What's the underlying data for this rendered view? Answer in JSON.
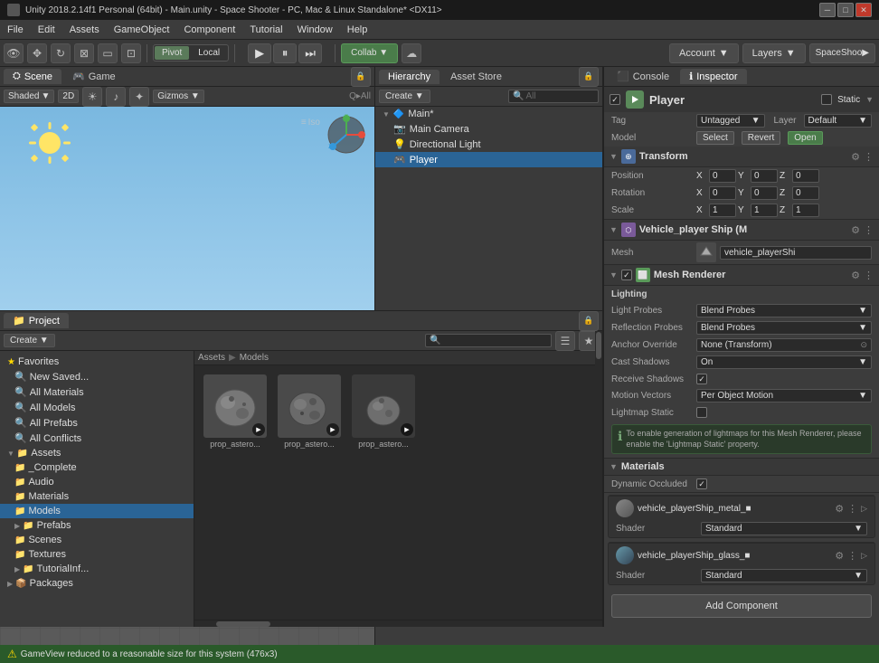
{
  "titleBar": {
    "title": "Unity 2018.2.14f1 Personal (64bit) - Main.unity - Space Shooter - PC, Mac & Linux Standalone* <DX11>",
    "minBtn": "─",
    "maxBtn": "□",
    "closeBtn": "✕"
  },
  "menuBar": {
    "items": [
      "File",
      "Edit",
      "Assets",
      "GameObject",
      "Component",
      "Tutorial",
      "Window",
      "Help"
    ]
  },
  "toolbar": {
    "pivot": "Pivot",
    "local": "Local",
    "play": "▶",
    "pause": "⏸",
    "step": "⏭",
    "collab": "Collab ▼",
    "cloud": "☁",
    "account": "Account",
    "layers": "Layers",
    "spaceShooter": "SpaceShoo▶"
  },
  "sceneTabs": {
    "scene": "Scene",
    "game": "Game"
  },
  "sceneToolbar": {
    "shading": "Shaded",
    "mode2d": "2D",
    "lighting": "☀",
    "audio": "♪",
    "effects": "✦",
    "gizmos": "Gizmos ▼",
    "allLabel": "All",
    "isoLabel": "Iso"
  },
  "hierarchy": {
    "title": "Hierarchy",
    "assetStore": "Asset Store",
    "createBtn": "Create ▼",
    "searchPlaceholder": "Q▶All",
    "items": [
      {
        "label": "Main*",
        "indent": 0,
        "hasArrow": true,
        "icon": "🔷"
      },
      {
        "label": "Main Camera",
        "indent": 1,
        "hasArrow": false,
        "icon": "📷"
      },
      {
        "label": "Directional Light",
        "indent": 1,
        "hasArrow": false,
        "icon": "💡"
      },
      {
        "label": "Player",
        "indent": 1,
        "hasArrow": false,
        "icon": "🎮",
        "selected": true
      }
    ]
  },
  "consoleTabs": {
    "console": "Console",
    "inspector": "Inspector"
  },
  "inspector": {
    "playerLabel": "Player",
    "staticLabel": "Static",
    "tag": "Untagged",
    "layer": "Default",
    "modelSelect": "Select",
    "modelRevert": "Revert",
    "modelOpen": "Open",
    "transform": {
      "label": "Transform",
      "positionLabel": "Position",
      "rotationLabel": "Rotation",
      "scaleLabel": "Scale",
      "posX": "0",
      "posY": "0",
      "posZ": "0",
      "rotX": "0",
      "rotY": "0",
      "rotZ": "0",
      "scaleX": "1",
      "scaleY": "1",
      "scaleZ": "1"
    },
    "vehicleShip": {
      "label": "Vehicle_player Ship (M",
      "meshLabel": "Mesh",
      "meshValue": "vehicle_playerShi"
    },
    "meshRenderer": {
      "label": "Mesh Renderer",
      "lightingLabel": "Lighting",
      "lightProbesLabel": "Light Probes",
      "lightProbesValue": "Blend Probes",
      "reflectionProbesLabel": "Reflection Probes",
      "reflectionProbesValue": "Blend Probes",
      "anchorOverrideLabel": "Anchor Override",
      "anchorOverrideValue": "None (Transform)",
      "castShadowsLabel": "Cast Shadows",
      "castShadowsValue": "On",
      "receiveShadowsLabel": "Receive Shadows",
      "motionVectorsLabel": "Motion Vectors",
      "motionVectorsValue": "Per Object Motion",
      "lightmapStaticLabel": "Lightmap Static",
      "lightmapInfo": "To enable generation of lightmaps for this Mesh Renderer, please enable the 'Lightmap Static' property.",
      "materialsLabel": "Materials",
      "dynamicOccludedLabel": "Dynamic Occluded"
    },
    "materials": [
      {
        "name": "vehicle_playerShip_metal_■",
        "shader": "Standard",
        "color": "#888888"
      },
      {
        "name": "vehicle_playerShip_glass_■",
        "shader": "Standard",
        "color": "#6699aa"
      }
    ],
    "shaderLabel": "Shader",
    "addComponent": "Add Component"
  },
  "project": {
    "title": "Project",
    "createBtn": "Create ▼",
    "searchPlaceholder": "🔍",
    "favorites": {
      "label": "Favorites",
      "items": [
        {
          "label": "New Saved..."
        },
        {
          "label": "All Materials"
        },
        {
          "label": "All Models"
        },
        {
          "label": "All Prefabs"
        },
        {
          "label": "All Conflicts"
        }
      ]
    },
    "assets": {
      "label": "Assets",
      "items": [
        {
          "label": "_Complete",
          "indent": 1
        },
        {
          "label": "Audio",
          "indent": 1
        },
        {
          "label": "Materials",
          "indent": 1
        },
        {
          "label": "Models",
          "indent": 1,
          "selected": true
        },
        {
          "label": "Prefabs",
          "indent": 1,
          "hasArrow": true
        },
        {
          "label": "Scenes",
          "indent": 1
        },
        {
          "label": "Textures",
          "indent": 1
        },
        {
          "label": "TutorialInf...",
          "indent": 1
        }
      ]
    },
    "packages": {
      "label": "Packages"
    },
    "breadcrumb": [
      "Assets",
      "Models"
    ],
    "files": [
      {
        "name": "prop_astero...",
        "thumb": "rock1"
      },
      {
        "name": "prop_astero...",
        "thumb": "rock2"
      },
      {
        "name": "prop_astero...",
        "thumb": "rock3"
      }
    ]
  },
  "statusBar": {
    "message": "GameView reduced to a reasonable size for this system (476x3)"
  }
}
